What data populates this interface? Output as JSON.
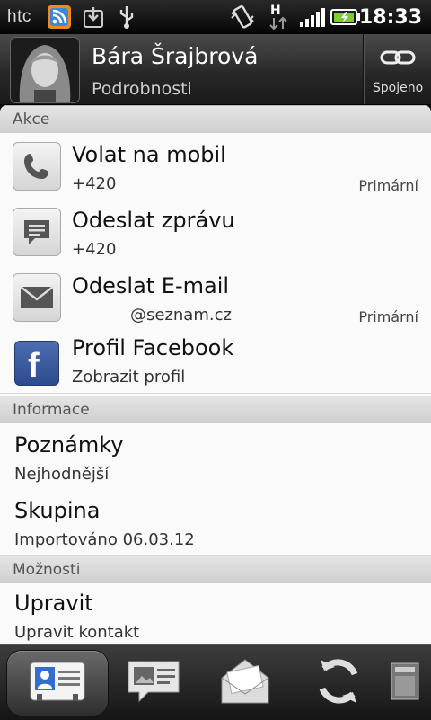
{
  "status_bar": {
    "brand": "htc",
    "time": "18:33",
    "icons": [
      "rss-icon",
      "download-icon",
      "usb-icon",
      "vibrate-icon",
      "hspa-data-icon",
      "signal-icon",
      "battery-charging-icon"
    ],
    "network": "H"
  },
  "header": {
    "name": "Bára Šrajbrová",
    "subtitle": "Podrobnosti",
    "link_label": "Spojeno"
  },
  "sections": {
    "actions": "Akce",
    "info": "Informace",
    "options": "Možnosti"
  },
  "actions": [
    {
      "icon": "phone-icon",
      "title": "Volat na mobil",
      "sub": "+420",
      "badge": "Primární"
    },
    {
      "icon": "message-icon",
      "title": "Odeslat zprávu",
      "sub": "+420",
      "badge": ""
    },
    {
      "icon": "email-icon",
      "title": "Odeslat E-mail",
      "sub": "@seznam.cz",
      "badge": "Primární"
    },
    {
      "icon": "facebook-icon",
      "title": "Profil Facebook",
      "sub": "Zobrazit profil",
      "badge": ""
    }
  ],
  "info": [
    {
      "title": "Poznámky",
      "sub": "Nejhodnější"
    },
    {
      "title": "Skupina",
      "sub": "Importováno 06.03.12"
    }
  ],
  "options": [
    {
      "title": "Upravit",
      "sub": "Upravit kontakt"
    }
  ],
  "tabs": [
    {
      "icon": "contact-card-icon",
      "active": true
    },
    {
      "icon": "gallery-message-icon",
      "active": false
    },
    {
      "icon": "mail-envelope-icon",
      "active": false
    },
    {
      "icon": "sync-icon",
      "active": false
    },
    {
      "icon": "media-icon",
      "active": false
    }
  ],
  "colors": {
    "battery": "#7ccf2a",
    "facebook": "#3b5998"
  }
}
